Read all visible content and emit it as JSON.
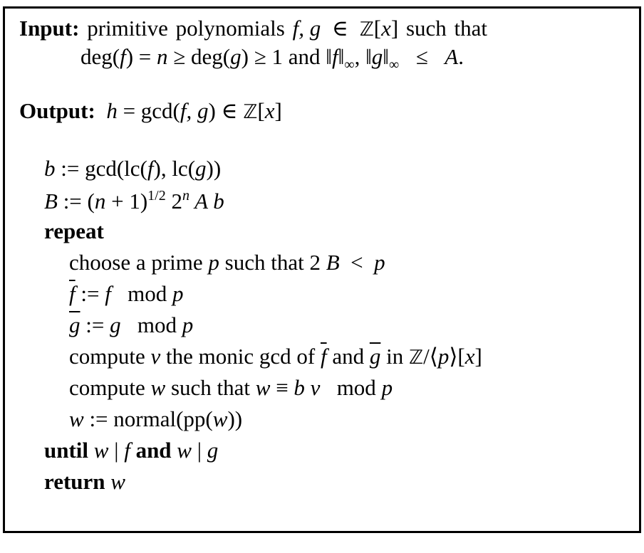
{
  "algorithm": {
    "input_label": "Input:",
    "output_label": "Output:",
    "lines": [
      {
        "id": "input-line-1",
        "indent": "label",
        "row": 0,
        "segs": [
          {
            "t": "Input:",
            "s": "b"
          },
          {
            "t": " primitive polynomials ",
            "s": "r",
            "ws": 3
          },
          {
            "t": "f, g",
            "s": "i"
          },
          {
            "t": " ∈ ",
            "s": "r",
            "ws": 8
          },
          {
            "t": "ℤ",
            "s": "bb"
          },
          {
            "t": "[",
            "s": "r"
          },
          {
            "t": "x",
            "s": "i"
          },
          {
            "t": "]",
            "s": "r"
          },
          {
            "t": " such that",
            "s": "r",
            "ws": 3
          }
        ]
      },
      {
        "id": "input-line-2",
        "indent": "cont",
        "row": 1,
        "segs": [
          {
            "t": "deg(",
            "s": "r"
          },
          {
            "t": "f",
            "s": "i"
          },
          {
            "t": ") = ",
            "s": "r"
          },
          {
            "t": "n",
            "s": "i"
          },
          {
            "t": " ≥ deg(",
            "s": "r"
          },
          {
            "t": "g",
            "s": "i"
          },
          {
            "t": ") ≥ 1 and ‖",
            "s": "r"
          },
          {
            "t": "f",
            "s": "i"
          },
          {
            "t": "‖",
            "s": "r"
          },
          {
            "t": "∞",
            "s": "sub"
          },
          {
            "t": ", ‖",
            "s": "r"
          },
          {
            "t": "g",
            "s": "i"
          },
          {
            "t": "‖",
            "s": "r"
          },
          {
            "t": "∞",
            "s": "sub"
          },
          {
            "t": "  ≤  ",
            "s": "r",
            "ws": 4
          },
          {
            "t": "A",
            "s": "i"
          },
          {
            "t": ".",
            "s": "r"
          }
        ]
      },
      {
        "id": "output-line",
        "indent": "label",
        "row": 2,
        "segs": [
          {
            "t": "Output:",
            "s": "b"
          },
          {
            "t": "  ",
            "s": "r"
          },
          {
            "t": "h",
            "s": "i"
          },
          {
            "t": " = gcd(",
            "s": "r"
          },
          {
            "t": "f, g",
            "s": "i"
          },
          {
            "t": ") ∈ ",
            "s": "r"
          },
          {
            "t": "ℤ",
            "s": "bb"
          },
          {
            "t": "[",
            "s": "r"
          },
          {
            "t": "x",
            "s": "i"
          },
          {
            "t": "]",
            "s": "r"
          }
        ]
      },
      {
        "id": "step-b",
        "indent": "l1",
        "row": 3,
        "segs": [
          {
            "t": "b",
            "s": "i"
          },
          {
            "t": " := gcd(lc(",
            "s": "r"
          },
          {
            "t": "f",
            "s": "i"
          },
          {
            "t": "), lc(",
            "s": "r"
          },
          {
            "t": "g",
            "s": "i"
          },
          {
            "t": "))",
            "s": "r"
          }
        ]
      },
      {
        "id": "step-B",
        "indent": "l1",
        "row": 4,
        "segs": [
          {
            "t": "B",
            "s": "i"
          },
          {
            "t": " := (",
            "s": "r"
          },
          {
            "t": "n",
            "s": "i"
          },
          {
            "t": " + 1)",
            "s": "r"
          },
          {
            "t": "1/2",
            "s": "sup"
          },
          {
            "t": " 2",
            "s": "r"
          },
          {
            "t": "n",
            "s": "supi"
          },
          {
            "t": " A b",
            "s": "i"
          }
        ]
      },
      {
        "id": "keyword-repeat",
        "indent": "l1",
        "row": 5,
        "segs": [
          {
            "t": "repeat",
            "s": "b"
          }
        ]
      },
      {
        "id": "step-choose-prime",
        "indent": "l2",
        "row": 6,
        "segs": [
          {
            "t": "choose a prime ",
            "s": "r"
          },
          {
            "t": "p",
            "s": "i"
          },
          {
            "t": " such that 2 ",
            "s": "r"
          },
          {
            "t": "B",
            "s": "i"
          },
          {
            "t": "  <  ",
            "s": "r"
          },
          {
            "t": "p",
            "s": "i"
          }
        ]
      },
      {
        "id": "step-fbar",
        "indent": "l2",
        "row": 7,
        "segs": [
          {
            "t": "f",
            "s": "iov"
          },
          {
            "t": " := ",
            "s": "r"
          },
          {
            "t": "f",
            "s": "i"
          },
          {
            "t": "   mod ",
            "s": "r"
          },
          {
            "t": "p",
            "s": "i"
          }
        ]
      },
      {
        "id": "step-gbar",
        "indent": "l2",
        "row": 8,
        "segs": [
          {
            "t": "g",
            "s": "iov"
          },
          {
            "t": " := ",
            "s": "r"
          },
          {
            "t": "g",
            "s": "i"
          },
          {
            "t": "   mod ",
            "s": "r"
          },
          {
            "t": "p",
            "s": "i"
          }
        ]
      },
      {
        "id": "step-compute-nu",
        "indent": "l2",
        "row": 9,
        "segs": [
          {
            "t": "compute ",
            "s": "r"
          },
          {
            "t": "ν",
            "s": "i"
          },
          {
            "t": " the monic gcd of ",
            "s": "r"
          },
          {
            "t": "f",
            "s": "iov"
          },
          {
            "t": " and ",
            "s": "r"
          },
          {
            "t": "g",
            "s": "iov"
          },
          {
            "t": " in ",
            "s": "r"
          },
          {
            "t": "ℤ",
            "s": "bb"
          },
          {
            "t": "/⟨",
            "s": "r"
          },
          {
            "t": "p",
            "s": "i"
          },
          {
            "t": "⟩[",
            "s": "r"
          },
          {
            "t": "x",
            "s": "i"
          },
          {
            "t": "]",
            "s": "r"
          }
        ]
      },
      {
        "id": "step-compute-w",
        "indent": "l2",
        "row": 10,
        "segs": [
          {
            "t": "compute ",
            "s": "r"
          },
          {
            "t": "w",
            "s": "i"
          },
          {
            "t": " such that ",
            "s": "r"
          },
          {
            "t": "w",
            "s": "i"
          },
          {
            "t": " ≡ ",
            "s": "r"
          },
          {
            "t": "b ν",
            "s": "i"
          },
          {
            "t": "   mod ",
            "s": "r"
          },
          {
            "t": "p",
            "s": "i"
          }
        ]
      },
      {
        "id": "step-normalize-w",
        "indent": "l2",
        "row": 11,
        "segs": [
          {
            "t": "w",
            "s": "i"
          },
          {
            "t": " := normal(pp(",
            "s": "r"
          },
          {
            "t": "w",
            "s": "i"
          },
          {
            "t": "))",
            "s": "r"
          }
        ]
      },
      {
        "id": "keyword-until",
        "indent": "l1",
        "row": 12,
        "segs": [
          {
            "t": "until",
            "s": "b"
          },
          {
            "t": " ",
            "s": "r"
          },
          {
            "t": "w",
            "s": "i"
          },
          {
            "t": " | ",
            "s": "r"
          },
          {
            "t": "f",
            "s": "i"
          },
          {
            "t": " and",
            "s": "b"
          },
          {
            "t": " ",
            "s": "r"
          },
          {
            "t": "w",
            "s": "i"
          },
          {
            "t": " | ",
            "s": "r"
          },
          {
            "t": "g",
            "s": "i"
          }
        ]
      },
      {
        "id": "keyword-return",
        "indent": "l1",
        "row": 13,
        "segs": [
          {
            "t": "return",
            "s": "b"
          },
          {
            "t": " ",
            "s": "r"
          },
          {
            "t": "w",
            "s": "i"
          }
        ]
      }
    ]
  }
}
